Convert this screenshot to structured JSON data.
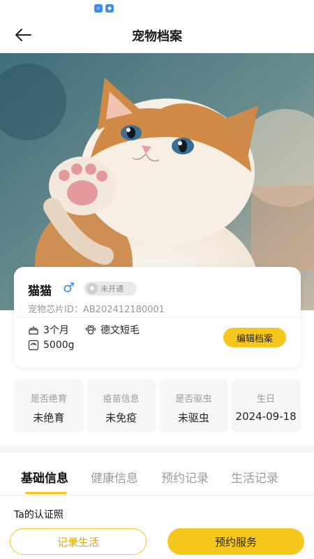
{
  "nav": {
    "title": "宠物档案",
    "back_icon": "arrow-left-icon"
  },
  "status_bar": {
    "icons": [
      "search-app-icon",
      "shield-app-icon"
    ]
  },
  "pet": {
    "name": "猫猫",
    "gender_symbol": "♂",
    "vip_status": "未开通",
    "chip_label": "宠物芯片ID：",
    "chip_id": "AB202412180001",
    "age": "3个月",
    "breed": "德文短毛",
    "weight": "5000g"
  },
  "actions": {
    "edit_label": "编辑档案"
  },
  "stats": [
    {
      "label": "是否绝育",
      "value": "未绝育"
    },
    {
      "label": "疫苗信息",
      "value": "未免疫"
    },
    {
      "label": "是否驱虫",
      "value": "未驱虫"
    },
    {
      "label": "生日",
      "value": "2024-09-18"
    }
  ],
  "tabs": [
    {
      "label": "基础信息",
      "active": true
    },
    {
      "label": "健康信息",
      "active": false
    },
    {
      "label": "预约记录",
      "active": false
    },
    {
      "label": "生活记录",
      "active": false
    }
  ],
  "section": {
    "cert_title": "Ta的认证照"
  },
  "bottom": {
    "record_label": "记录生活",
    "booking_label": "预约服务"
  },
  "colors": {
    "accent": "#f6c71c",
    "gender": "#3a8ee6",
    "muted": "#9a9a9a"
  }
}
